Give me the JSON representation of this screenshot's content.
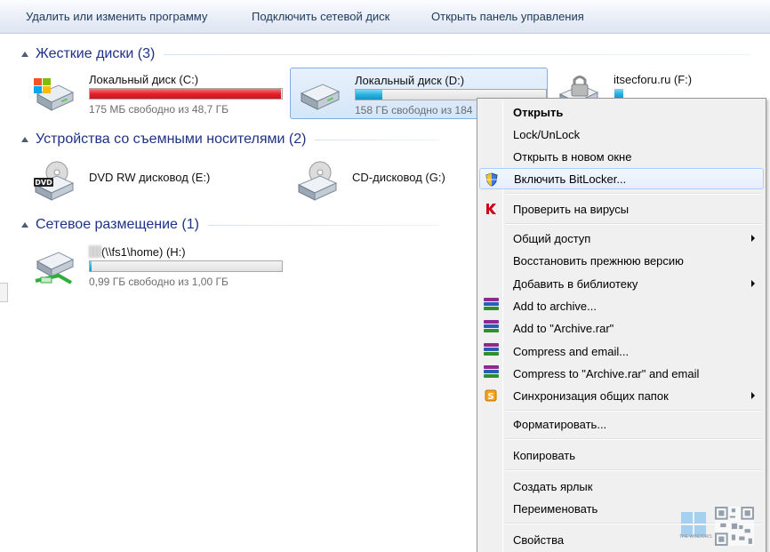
{
  "command_bar": {
    "buttons": [
      "Удалить или изменить программу",
      "Подключить сетевой диск",
      "Открыть панель управления"
    ]
  },
  "groups": {
    "hard_drives": {
      "title": "Жесткие диски (3)",
      "drives": [
        {
          "name": "Локальный диск (C:)",
          "free_text": "175 МБ свободно из 48,7 ГБ",
          "used_fraction": 0.996,
          "bar_color": "#e5232b"
        },
        {
          "name": "Локальный диск (D:)",
          "free_text": "158 ГБ свободно из 184",
          "used_fraction": 0.14,
          "bar_color": "#28b1e0"
        },
        {
          "name": "itsecforu.ru (F:)",
          "used_fraction": 0.05,
          "bar_color": "#28b1e0"
        }
      ]
    },
    "removable": {
      "title": "Устройства со съемными носителями (2)",
      "drives": [
        {
          "name": "DVD RW дисковод (E:)",
          "badge": "DVD"
        },
        {
          "name": "CD-дисковод (G:)"
        }
      ]
    },
    "network": {
      "title": "Сетевое размещение (1)",
      "drives": [
        {
          "name": "(\\\\fs1\\home) (H:)",
          "free_text": "0,99 ГБ свободно из 1,00 ГБ",
          "used_fraction": 0.01
        }
      ]
    }
  },
  "context_menu": {
    "items": [
      {
        "label": "Открыть",
        "bold": true
      },
      {
        "label": "Lock/UnLock"
      },
      {
        "label": "Открыть в новом окне"
      },
      {
        "label": "Включить BitLocker...",
        "icon": "shield-icon",
        "highlighted": true
      },
      {
        "label": "Проверить на вирусы",
        "icon": "kaspersky-icon"
      },
      {
        "label": "Общий доступ",
        "submenu": true
      },
      {
        "label": "Восстановить прежнюю версию"
      },
      {
        "label": "Добавить в библиотеку",
        "submenu": true
      },
      {
        "label": "Add to archive...",
        "icon": "winrar-icon"
      },
      {
        "label": "Add to \"Archive.rar\"",
        "icon": "winrar-icon"
      },
      {
        "label": "Compress and email...",
        "icon": "winrar-icon"
      },
      {
        "label": "Compress to \"Archive.rar\" and email",
        "icon": "winrar-icon"
      },
      {
        "label": "Синхронизация общих папок",
        "icon": "sync-icon",
        "submenu": true
      },
      {
        "label": "Форматировать..."
      },
      {
        "label": "Копировать"
      },
      {
        "label": "Создать ярлык"
      },
      {
        "label": "Переименовать"
      },
      {
        "label": "Свойства"
      }
    ]
  },
  "watermark": {
    "caption": "THE WINDOWS"
  }
}
